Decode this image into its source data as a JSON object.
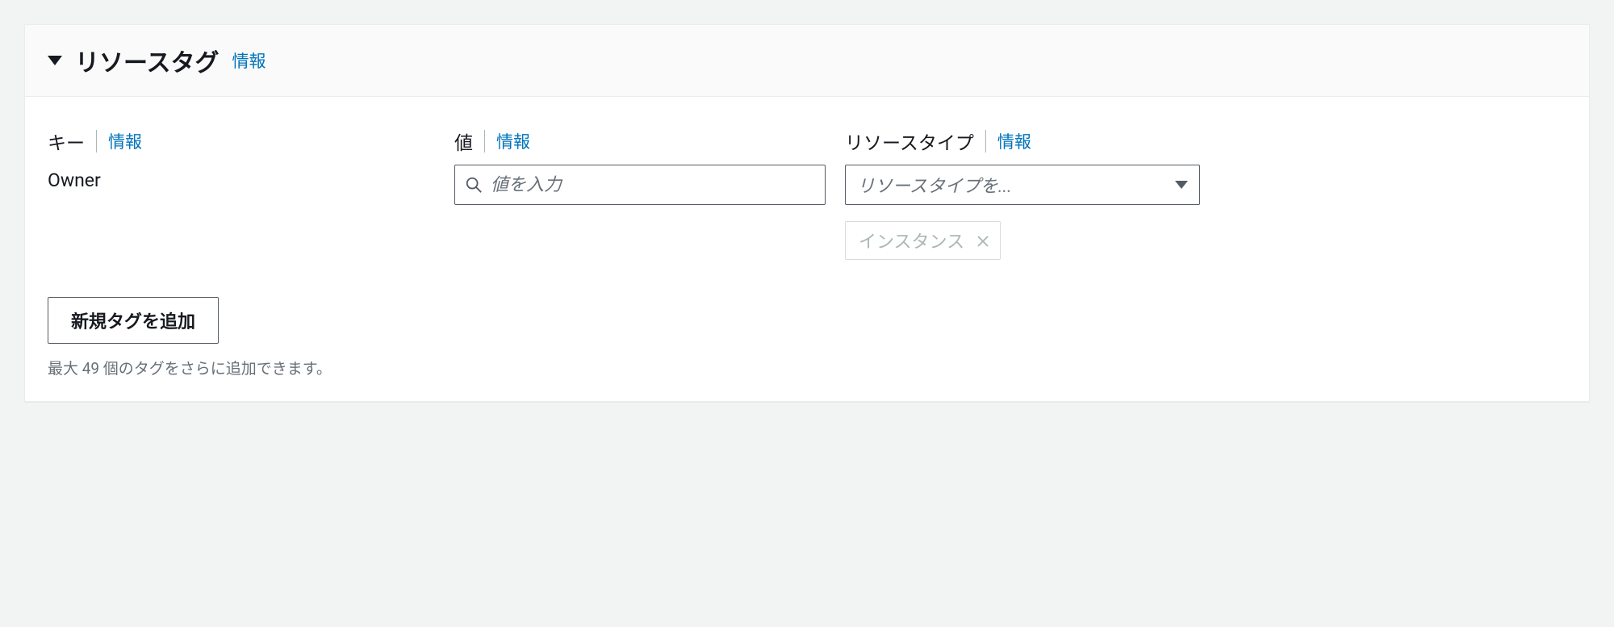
{
  "panel": {
    "title": "リソースタグ",
    "info_label": "情報"
  },
  "columns": {
    "key": {
      "label": "キー",
      "info_label": "情報",
      "value": "Owner"
    },
    "value": {
      "label": "値",
      "info_label": "情報",
      "placeholder": "値を入力"
    },
    "resource_type": {
      "label": "リソースタイプ",
      "info_label": "情報",
      "placeholder": "リソースタイプを...",
      "chip": "インスタンス"
    }
  },
  "add_button": "新規タグを追加",
  "hint": "最大 49 個のタグをさらに追加できます。"
}
